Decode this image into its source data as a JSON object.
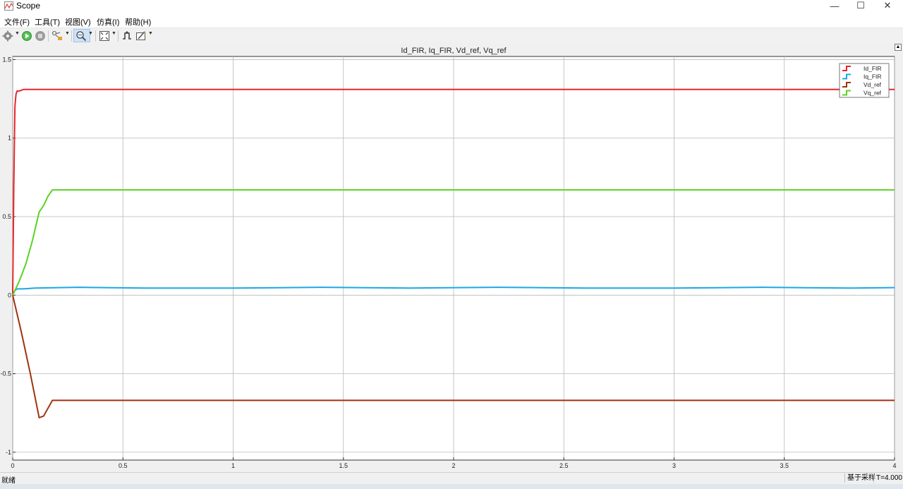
{
  "window": {
    "title": "Scope",
    "minimize_glyph": "—",
    "maximize_glyph": "☐",
    "close_glyph": "✕"
  },
  "menu": [
    {
      "label": "文件(F)"
    },
    {
      "label": "工具(T)"
    },
    {
      "label": "视图(V)"
    },
    {
      "label": "仿真(I)"
    },
    {
      "label": "帮助(H)"
    }
  ],
  "toolbar": {
    "icons": [
      "settings-icon",
      "run-icon",
      "stop-icon",
      "highlight-block-icon",
      "zoom-icon",
      "autoscale-icon",
      "triggers-icon",
      "measurements-icon"
    ],
    "accent": "#1e88e5"
  },
  "status": {
    "ready": "就绪",
    "sample_mode": "基于采样",
    "time": "T=4.000"
  },
  "chart_data": {
    "type": "line",
    "title": "Id_FIR, Iq_FIR, Vd_ref, Vq_ref",
    "xlabel": "",
    "ylabel": "",
    "xlim": [
      0,
      4
    ],
    "ylim": [
      -1.05,
      1.52
    ],
    "xticks": [
      "0",
      "0.5",
      "1",
      "1.5",
      "2",
      "2.5",
      "3",
      "3.5",
      "4"
    ],
    "yticks": [
      "-1",
      "-0.5",
      "0",
      "0.5",
      "1",
      "1.5"
    ],
    "grid": true,
    "legend_position": "top-right",
    "series": [
      {
        "name": "Id_FIR",
        "color": "#e8262b",
        "x": [
          0,
          0.005,
          0.01,
          0.015,
          0.02,
          0.03,
          0.05,
          0.1,
          0.3,
          0.6,
          1.0,
          1.4,
          1.8,
          2.2,
          2.6,
          3.0,
          3.4,
          3.8,
          4.0
        ],
        "y": [
          0,
          0.7,
          1.2,
          1.28,
          1.3,
          1.3,
          1.31,
          1.31,
          1.31,
          1.31,
          1.31,
          1.31,
          1.31,
          1.31,
          1.31,
          1.31,
          1.31,
          1.31,
          1.31
        ]
      },
      {
        "name": "Iq_FIR",
        "color": "#1ba8e6",
        "x": [
          0,
          0.01,
          0.02,
          0.05,
          0.1,
          0.3,
          0.6,
          1.0,
          1.4,
          1.8,
          2.2,
          2.6,
          3.0,
          3.4,
          3.8,
          4.0
        ],
        "y": [
          0,
          0.03,
          0.04,
          0.04,
          0.045,
          0.05,
          0.045,
          0.045,
          0.05,
          0.045,
          0.05,
          0.045,
          0.045,
          0.05,
          0.045,
          0.048
        ]
      },
      {
        "name": "Vd_ref",
        "color": "#a0320f",
        "x": [
          0,
          0.04,
          0.08,
          0.12,
          0.14,
          0.16,
          0.18,
          0.5,
          1.0,
          2.0,
          3.0,
          4.0
        ],
        "y": [
          0,
          -0.24,
          -0.5,
          -0.78,
          -0.77,
          -0.72,
          -0.67,
          -0.67,
          -0.67,
          -0.67,
          -0.67,
          -0.67
        ]
      },
      {
        "name": "Vq_ref",
        "color": "#5bd322",
        "x": [
          0,
          0.03,
          0.06,
          0.09,
          0.12,
          0.13,
          0.14,
          0.16,
          0.18,
          0.5,
          1.0,
          2.0,
          3.0,
          4.0
        ],
        "y": [
          0,
          0.09,
          0.2,
          0.35,
          0.53,
          0.55,
          0.57,
          0.63,
          0.67,
          0.67,
          0.67,
          0.67,
          0.67,
          0.67
        ]
      }
    ]
  }
}
